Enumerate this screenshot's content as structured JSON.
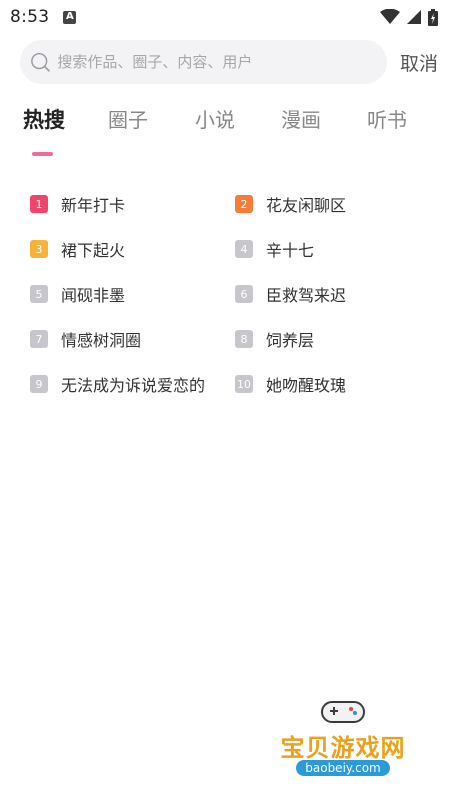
{
  "status_bar": {
    "time": "8:53",
    "notification_glyph": "A"
  },
  "search": {
    "placeholder": "搜索作品、圈子、内容、用户",
    "cancel_label": "取消"
  },
  "tabs": [
    {
      "label": "热搜",
      "active": true
    },
    {
      "label": "圈子",
      "active": false
    },
    {
      "label": "小说",
      "active": false
    },
    {
      "label": "漫画",
      "active": false
    },
    {
      "label": "听书",
      "active": false
    }
  ],
  "hot_list": [
    {
      "rank": "1",
      "title": "新年打卡",
      "color": "#f0456a"
    },
    {
      "rank": "2",
      "title": "花友闲聊区",
      "color": "#f57c3a"
    },
    {
      "rank": "3",
      "title": "裙下起火",
      "color": "#f6b23a"
    },
    {
      "rank": "4",
      "title": "辛十七",
      "color": "#c6c6cc"
    },
    {
      "rank": "5",
      "title": "闻砚非墨",
      "color": "#c6c6cc"
    },
    {
      "rank": "6",
      "title": "臣救驾来迟",
      "color": "#c6c6cc"
    },
    {
      "rank": "7",
      "title": "情感树洞圈",
      "color": "#c6c6cc"
    },
    {
      "rank": "8",
      "title": "饲养层",
      "color": "#c6c6cc"
    },
    {
      "rank": "9",
      "title": "无法成为诉说爱恋的",
      "color": "#c6c6cc"
    },
    {
      "rank": "10",
      "title": "她吻醒玫瑰",
      "color": "#c6c6cc"
    }
  ],
  "watermark": {
    "text": "宝贝游戏网",
    "url": "baobeiy.com"
  },
  "colors": {
    "accent": "#ee6c9c",
    "search_bg": "#f3f3f5"
  }
}
